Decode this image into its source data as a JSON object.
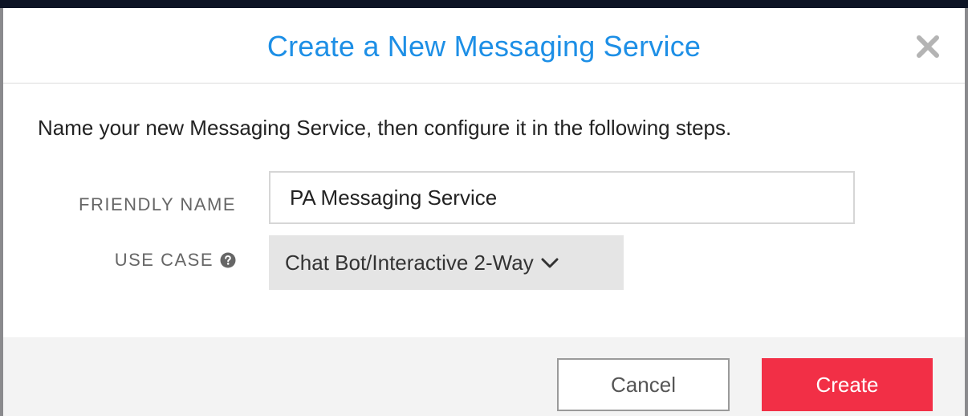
{
  "modal": {
    "title": "Create a New Messaging Service",
    "close_icon": "close-icon"
  },
  "body": {
    "intro": "Name your new Messaging Service, then configure it in the following steps.",
    "friendly_name": {
      "label": "FRIENDLY NAME",
      "value": "PA Messaging Service"
    },
    "use_case": {
      "label": "USE CASE",
      "help_icon": "question-circle-icon",
      "selected": "Chat Bot/Interactive 2-Way",
      "dropdown_icon": "chevron-down-icon"
    }
  },
  "footer": {
    "cancel_label": "Cancel",
    "create_label": "Create"
  },
  "colors": {
    "title": "#1d8fe6",
    "create_button": "#f22f46",
    "footer_bg": "#f3f3f3",
    "select_bg": "#e5e5e5"
  }
}
